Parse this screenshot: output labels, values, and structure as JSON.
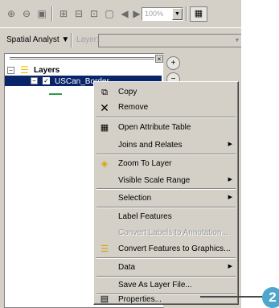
{
  "toolbar": {
    "zoom_value": "100%",
    "buttons": [
      "zoom-in-icon",
      "zoom-out-icon",
      "fixed-zoom-icon",
      "full-extent-icon",
      "page-width-icon",
      "page-height-icon",
      "actual-size-icon",
      "back-extent-icon",
      "forward-extent-icon",
      "layout-icon"
    ]
  },
  "toolbar2": {
    "spatial_analyst": "Spatial Analyst ▼",
    "layer_label": "Layer:"
  },
  "toc": {
    "root_label": "Layers",
    "layer_name": "USCan_Border",
    "legend_color": "#2e9b48"
  },
  "menu": {
    "items": [
      {
        "label": "Copy",
        "icon": "copy-icon",
        "enabled": true,
        "submenu": false
      },
      {
        "label": "Remove",
        "icon": "remove-icon",
        "enabled": true,
        "submenu": false
      },
      {
        "label": "Open Attribute Table",
        "icon": "table-icon",
        "enabled": true,
        "submenu": false
      },
      {
        "label": "Joins and Relates",
        "icon": "",
        "enabled": true,
        "submenu": true
      },
      {
        "label": "Zoom To Layer",
        "icon": "zoom-to-layer-icon",
        "enabled": true,
        "submenu": false
      },
      {
        "label": "Visible Scale Range",
        "icon": "",
        "enabled": true,
        "submenu": true
      },
      {
        "label": "Selection",
        "icon": "",
        "enabled": true,
        "submenu": true
      },
      {
        "label": "Label Features",
        "icon": "",
        "enabled": true,
        "submenu": false
      },
      {
        "label": "Convert Labels to Annotation...",
        "icon": "",
        "enabled": false,
        "submenu": false
      },
      {
        "label": "Convert Features to Graphics...",
        "icon": "convert-graphics-icon",
        "enabled": true,
        "submenu": false
      },
      {
        "label": "Data",
        "icon": "",
        "enabled": true,
        "submenu": true
      },
      {
        "label": "Save As Layer File...",
        "icon": "",
        "enabled": true,
        "submenu": false
      },
      {
        "label": "Properties...",
        "icon": "properties-icon",
        "enabled": true,
        "submenu": false
      }
    ]
  },
  "callout": {
    "number": "2",
    "color": "#4ea6cc"
  }
}
